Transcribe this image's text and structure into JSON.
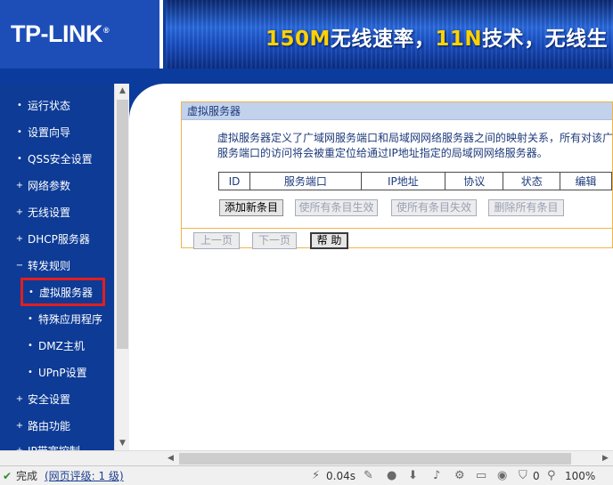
{
  "header": {
    "logo": "TP-LINK",
    "banner_parts": [
      "150M",
      "无线速率，",
      "11N",
      "技术，无线生"
    ]
  },
  "menu": {
    "items": [
      {
        "label": "运行状态",
        "bullet": "•"
      },
      {
        "label": "设置向导",
        "bullet": "•"
      },
      {
        "label": "QSS安全设置",
        "bullet": "•"
      },
      {
        "label": "网络参数",
        "bullet": "+"
      },
      {
        "label": "无线设置",
        "bullet": "+"
      },
      {
        "label": "DHCP服务器",
        "bullet": "+"
      },
      {
        "label": "转发规则",
        "bullet": "−"
      },
      {
        "label": "虚拟服务器",
        "bullet": "•"
      },
      {
        "label": "特殊应用程序",
        "bullet": "•"
      },
      {
        "label": "DMZ主机",
        "bullet": "•"
      },
      {
        "label": "UPnP设置",
        "bullet": "•"
      },
      {
        "label": "安全设置",
        "bullet": "+"
      },
      {
        "label": "路由功能",
        "bullet": "+"
      },
      {
        "label": "IP带宽控制",
        "bullet": "+"
      }
    ]
  },
  "panel": {
    "title": "虚拟服务器",
    "desc_line1": "虚拟服务器定义了广域网服务端口和局域网网络服务器之间的映射关系，所有对该广",
    "desc_line2": "服务端口的访问将会被重定位给通过IP地址指定的局域网网络服务器。",
    "columns": [
      "ID",
      "服务端口",
      "IP地址",
      "协议",
      "状态",
      "编辑"
    ],
    "buttons": {
      "add": "添加新条目",
      "enable_all": "使所有条目生效",
      "disable_all": "使所有条目失效",
      "delete_all": "删除所有条目",
      "prev": "上一页",
      "next": "下一页",
      "help": "帮 助"
    }
  },
  "statusbar": {
    "status": "完成",
    "rating": "(网页评级: 1 级)",
    "speed": "0.04s",
    "count": "0",
    "zoom": "100%"
  }
}
